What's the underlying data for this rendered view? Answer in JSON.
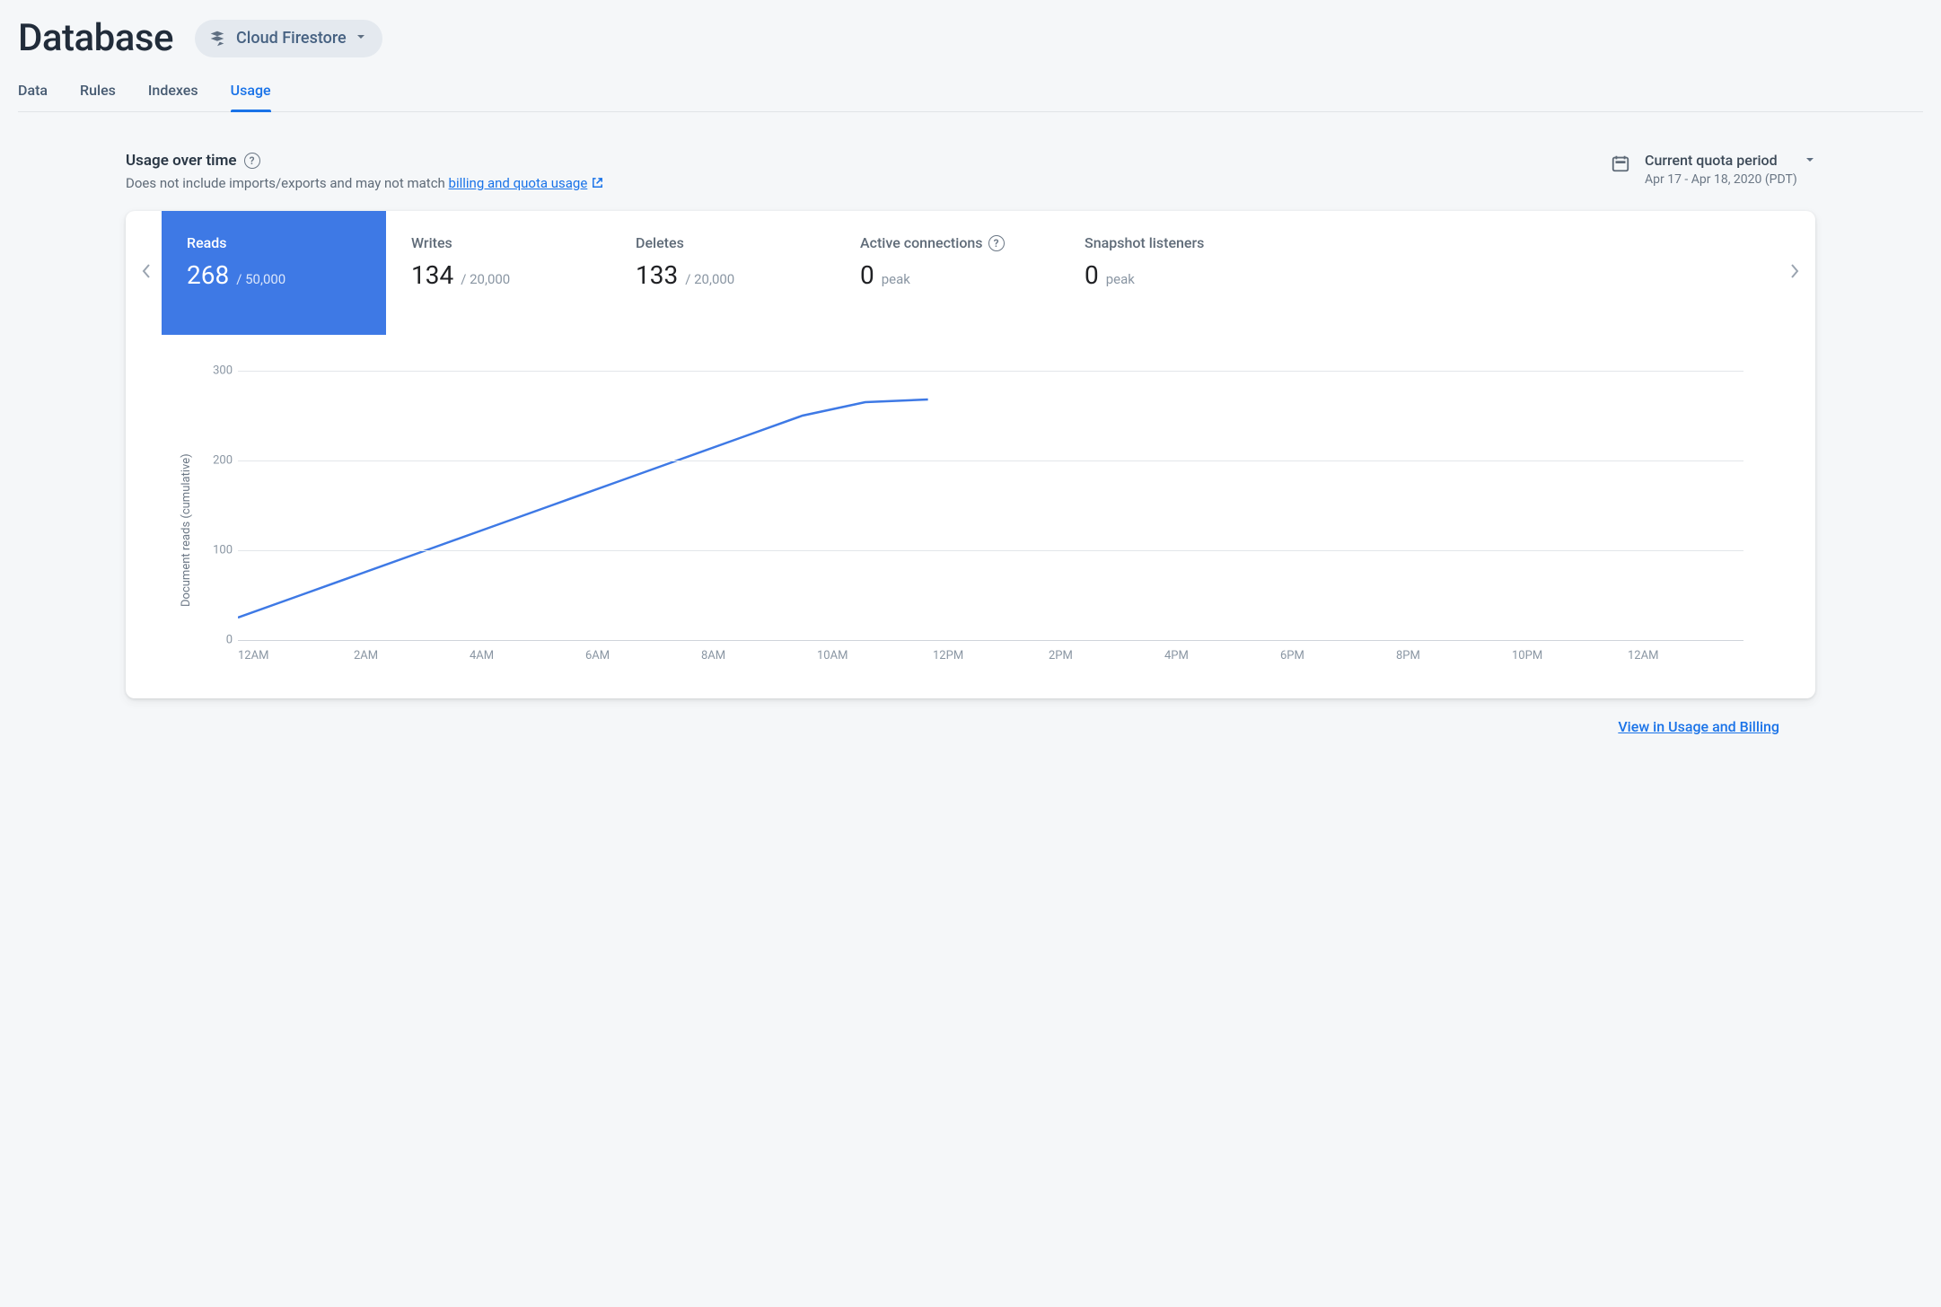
{
  "header": {
    "title": "Database",
    "selector_label": "Cloud Firestore"
  },
  "tabs": [
    {
      "label": "Data",
      "active": false
    },
    {
      "label": "Rules",
      "active": false
    },
    {
      "label": "Indexes",
      "active": false
    },
    {
      "label": "Usage",
      "active": true
    }
  ],
  "section": {
    "title": "Usage over time",
    "subtitle_prefix": "Does not include imports/exports and may not match ",
    "subtitle_link": "billing and quota usage",
    "period_label": "Current quota period",
    "period_range": "Apr 17 - Apr 18, 2020 (PDT)"
  },
  "metrics": [
    {
      "label": "Reads",
      "value": "268",
      "suffix": "/ 50,000",
      "active": true,
      "help": false
    },
    {
      "label": "Writes",
      "value": "134",
      "suffix": "/ 20,000",
      "active": false,
      "help": false
    },
    {
      "label": "Deletes",
      "value": "133",
      "suffix": "/ 20,000",
      "active": false,
      "help": false
    },
    {
      "label": "Active connections",
      "value": "0",
      "suffix": "peak",
      "active": false,
      "help": true
    },
    {
      "label": "Snapshot listeners",
      "value": "0",
      "suffix": "peak",
      "active": false,
      "help": false
    }
  ],
  "chart_data": {
    "type": "line",
    "title": "",
    "ylabel": "Document reads (cumulative)",
    "xlabel": "",
    "ylim": [
      0,
      300
    ],
    "yticks": [
      0,
      100,
      200,
      300
    ],
    "categories": [
      "12AM",
      "2AM",
      "4AM",
      "6AM",
      "8AM",
      "10AM",
      "12PM",
      "2PM",
      "4PM",
      "6PM",
      "8PM",
      "10PM",
      "12AM"
    ],
    "x_hours": [
      0,
      2,
      4,
      6,
      8,
      10,
      12,
      14,
      16,
      18,
      20,
      22,
      24
    ],
    "series": [
      {
        "name": "Reads",
        "x": [
          0,
          1,
          2,
          3,
          4,
          5,
          6,
          7,
          8,
          9,
          10,
          11
        ],
        "values": [
          25,
          50,
          75,
          100,
          125,
          150,
          175,
          200,
          225,
          250,
          265,
          268
        ]
      }
    ]
  },
  "footer": {
    "link_label": "View in Usage and Billing"
  }
}
